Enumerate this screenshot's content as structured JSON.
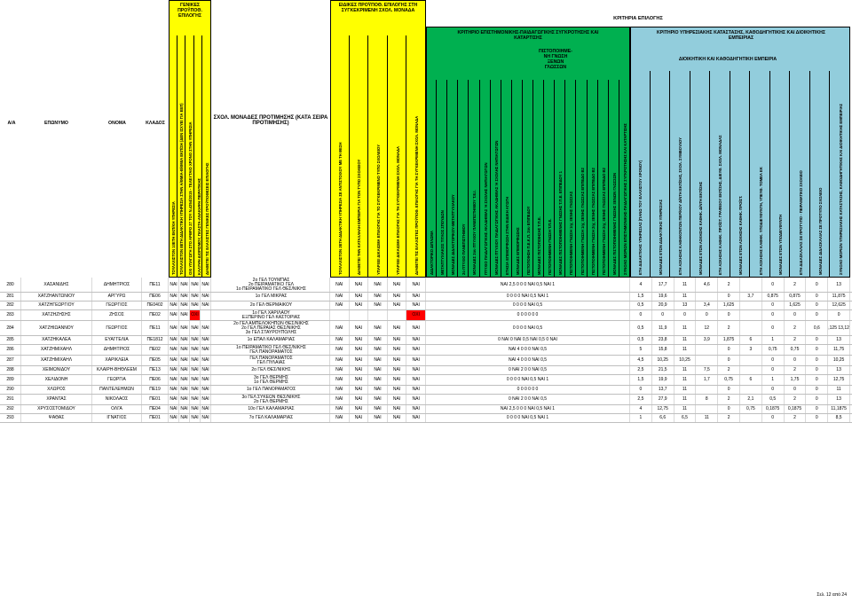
{
  "header": {
    "col_aa": "Α/Α",
    "col_surname": "ΕΠΩΝΥΜΟ",
    "col_name": "ΟΝΟΜΑ",
    "col_branch": "ΚΛΑΔΟΣ",
    "general_top": "ΓΕΝΙΚΕΣ ΠΡΟΫΠΟΘ. ΕΠΙΛΟΓΗΣ",
    "special_top": "ΕΙΔΙΚΕΣ ΠΡΟΫΠΟΘ. ΕΠΙΛΟΓΗΣ ΣΤΗ ΣΥΓΚΕΚΡΙΜΕΝΗ ΣΧΟΛ. ΜΟΝΑΔΑ",
    "criteria_top": "ΚΡΙΤΗΡΙΑ ΕΠΙΛΟΓΗΣ",
    "scientific": "ΚΡΙΤΗΡΙΟ ΕΠΙΣΤΗΜΟΝΙΚΗΣ-ΠΑΙΔΑΓΩΓΙΚΗΣ ΣΥΓΚΡΟΤΗΣΗΣ ΚΑΙ ΚΑΤΑΡΤΙΣΗΣ",
    "service": "ΚΡΙΤΗΡΙΟ ΥΠΗΡΕΣΙΑΚΗΣ ΚΑΤΑΣΤΑΣΗΣ, ΚΑΘΟΔΗΓΗΤΙΚΗΣ ΚΑΙ ΔΙΟΙΚΗΤΙΚΗΣ ΕΜΠΕΙΡΙΑΣ",
    "languages": "ΠΙΣΤΟΠΟΙΗΜΕ- ΝΗ ΓΝΩΣΗ ΞΕΝΩΝ ΓΛΩΣΣΩΝ",
    "admin": "ΔΙΟΙΚΗΤΙΚΗ ΚΑΙ ΚΑΘΟΔΗΓΗΤΙΚΗ ΕΜΠΕΙΡΙΑ",
    "school_pref": "ΣΧΟΛ. ΜΟΝΑΔΕΣ ΠΡΟΤΙΜΗΣΗΣ (ΚΑΤΑ ΣΕΙΡΑ ΠΡΟΤΙΜΗΣΗΣ)",
    "general_cols": [
      "ΤΟΥΛΑΧΙΣΤΟΝ 10ΕΤΗ ΕΚΠ/ΚΗ ΥΠΗΡΕΣΙΑ",
      "ΤΟΥΛΑΧΙΣΤΟΝ 8ΕΤΗ ΔΙΔΑΚΤΙΚΗ ΥΠΗΡΕΣΙΑ ΣΤΗΝ Α/ΘΜΙΑ-Β/ΘΜΙΑ ΕΚΠ/ΣΗ (ΔΕΝ ΙΣΧΥΕΙ ΓΙΑ ΕΕΠ)",
      "ΟΧΙ ΥΠΑΓΩΓΗ ΣΤΟ ΑΡΘΡΟ 27 ΤΟΥ Ν.4354/2015 - ΤΕΛΕΥΤΑΙΟ ΧΡΟΝΟ ΣΤΗΝ ΥΠΗΡΕΣΙΑ",
      "ΚΑΛΥΨΗ ΔΙΟΡΙΣΜΟΥ, ΠΛΑΣΤΑ-ΑΝΑΚΗΨΗ ΠΕΙΡΑΤΙΚΗΣ",
      "ΔΙΑΘΕΤΕΙ ΤΙΣ ΕΛΑΧΙΣΤΕΣ ΓΕΝΙΚΕΣ ΠΡΟΫΠΟΘΕΣΕΙΣ ΕΠΙΛΟΓΗΣ"
    ],
    "special_cols": [
      "ΤΟΥΛΑΧΙΣΤΟΝ 3ΕΤΗ ΔΙΔΑΚΤΙΚΗ ΥΠΗΡΕΣΙΑ ΣΕ ΑΝΤΙΣΤΟΙΧΟΥ ΜΕ ΤΗ ΘΕΣΗ",
      "ΔΙΑΘΕΤΕΙ ΤΗΝ ΚΑΤΑΛΛΗΛΗ ΕΜΠΕΙΡΙΑ ΓΙΑ ΤΟΝ ΤΥΠΟ ΣΧΟΛΕΙΟΥ",
      "ΥΠΑΡΧΕΙ ΔΙΚΑΙΩΜΑ ΕΠΙΛΟΓΗΣ ΓΙΑ ΤΟ ΣΥΓΚΕΚΡΙΜΕΝΟ ΤΥΠΟ ΣΧΟΛΕΙΟΥ",
      "ΥΠΑΡΧΕΙ ΔΙΚΑΙΩΜΑ ΕΠΙΛΟΓΗΣ ΓΙΑ ΤΗ ΣΥΓΚΕΚΡΙΜΕΝΗ ΣΧΟΛ. ΜΟΝΑΔΑ",
      "ΔΙΑΘΕΤΕΙ ΤΙΣ ΕΛΑΧΙΣΤΕΣ ΠΡΟΫΠΟΘ. ΕΠΙΛΟΓΗΣ ΓΙΑ ΤΗ ΣΥΓΚΕΚΡΙΜΕΝΗ ΣΧΟΛ. ΜΟΝΑΔΑ"
    ],
    "sci_cols": [
      "ΔΙΔΑΚΤΟΡΙΚΟ ΔΙΠΛΩΜΑ",
      "ΜΕΤΑΠΤΥΧΙΑΚΟΣ ΤΙΤΛΟΣ ΣΠΟΥΔΩΝ",
      "ΜΟΝΑΔΕΣ ΔΙΔΑΚΤΟΡΙΚΟΥ-ΜΕΤΑΠΤΥΧΙΑΚΟΥ",
      "2ο ΠΤΥΧΙΟ ΠΑΝΕΠΙΣΤΗΜΙΟΥ",
      "ΜΟΝΑΔΕΣ 2ου ΠΤΥΧΙΟΥ ΠΑΝΕΠΙΣΤΗΜΙΟΥ Τ.Ε.Ι.",
      "ΠΤΥΧΙΟ ΠΑΙΔΑΓΩΓΙΚΗΣ ΑΚΑΔΗΜΙΑΣ Ή ΣΧΟΛΗΣ ΝΗΠΙΑΓΩΓΩΝ",
      "ΜΟΝΑΔΕΣ ΠΤΥΧΙΟΥ ΠΑΙΔΑΓΩΓΙΚΗΣ ΑΚΑΔΗΜΙΑΣ Ή ΣΧΟΛΗΣ ΝΗΠΙΑΓΩΓΩΝ",
      "ΕΤΗΣΙΑ ΕΠΙΜΟΡΦΩΣΗ ΣΤΗΝ ΕΙΔΙΚΗ ΑΓΩΓΗ",
      "ΜΟΝΑΔΕΣ ΕΠΙΜΟΡΦΩΣΗΣ",
      "ΠΙΣΤΟΠΟΙΗΣΗ Π.Ε.Κ.Π. 2ου ΕΠΙΠΕΔΟΥ",
      "ΜΟΝΑΔΕΣ ΠΙΣΤΟΠΟΙΗΣΗΣ Τ.Π.Ε.",
      "ΠΙΣΤΟΠΟΙΗΜΕΝΗ ΓΝΩΣΗ Τ.Π.Ε.",
      "ΜΟΝΑΔΕΣ ΠΙΣΤΟΠΟΙΗΜΕΝΗΣ ΓΝΩΣΗΣ Τ.Π.Ε. ΕΠΙΠΕΔΟΥ 1",
      "ΠΙΣΤΟΠΟΙΗΜΕΝΗ ΓΝΩΣΗ 1ης ΞΕΝΗΣ ΓΛΩΣΣΑΣ",
      "ΠΙΣΤΟΠΟΙΗΜΕΝΗ ΓΝΩΣΗ 1ης ΞΕΝΗΣ ΓΛΩΣΣΑΣ ΕΠΙΠΕΔΟ Β2",
      "ΠΙΣΤΟΠΟΙΗΜΕΝΗ ΓΝΩΣΗ 2ης ΞΕΝΗΣ ΓΛΩΣΣΑΣ ΕΠΙΠΕΔΟ Β2",
      "ΠΙΣΤΟΠΟΙΗΜΕΝΗ ΓΝΩΣΗ 2ης ΞΕΝΗΣ ΓΛΩΣΣΑΣ ΕΠΙΠΕΔΟ Β2",
      "ΜΟΝΑΔΕΣ ΠΙΣΤΟΠΟΙΗΜΕΝΗΣ ΓΝΩΣΗΣ ΞΕΝΩΝ ΓΛΩΣΣΩΝ",
      "ΣΥΝΟΛΟ ΜΟΡΙΩΝ ΕΠΙΣΤΗΜΟΝΙΚΗΣ-ΠΑΙΔΑΓΩΓΙΚΗΣ ΣΥΓΚΡΟΤΗΣΗΣ ΚΑΙ ΚΑΤΑΡΤΙΣΗΣ"
    ],
    "srv_cols": [
      "ΕΤΗ ΔΙΔΑΚΤΙΚΗΣ ΥΠΗΡΕΣΙΑΣ (ΠΑΝΩ ΤΟΥ ΕΛΑΧΙΣΤΟΥ ΧΡΟΝΟΥ)",
      "ΜΟΝΑΔΕΣ ΕΤΩΝ ΔΙΔΑΚΤΙΚΗΣ ΥΠΗΡΕΣΙΑΣ",
      "ΕΤΗ ΑΣΚΗΣΗΣ ΚΑΘΗΚΟΝΤΩΝ ΠΕΡ/ΚΟΥ Δ/ΝΤΗ ΕΚΠ/ΣΗΣ, ΣΧΟΛ. ΣΥΜΒΟΥΛΟΥ",
      "ΜΟΝΑΔΕΣ ΕΤΩΝ ΑΣΚΗΣΗΣ ΚΑΘΗΚ. Δ/ΝΤΗ ΕΚΠ/ΣΗΣ",
      "ΕΤΗ ΑΣΚΗΣΗΣ ΚΑΘΗΚ. ΠΡΟΪΣΤ. ΓΡΑΦΕΙΟΥ ΕΚΠ/ΣΗΣ, ΔΙΕΥΘ. ΣΧΟΛ. ΜΟΝΑΔΑΣ",
      "ΜΟΝΑΔΕΣ ΕΤΩΝ ΑΣΚΗΣΗΣ ΚΑΘΗΚ. ΠΡΟΪΣΤ.",
      "ΕΤΗ ΑΣΚΗΣΗΣ ΚΑΘΗΚ. ΥΠΟΔΙΕΥΘΥΝΤΗ, ΥΠΕΥΘ. ΤΟΜΕΑ ΕΚ",
      "ΜΟΝΑΔΕΣ ΕΤΩΝ ΥΠΟΔΙΕΥΘΥΝΤΗ",
      "ΕΤΗ ΔΙΔΑΣΚΑΛΙΑΣ ΣΕ ΠΡΟΤΥΠΟ - ΠΕΙΡΑΜΑΤΙΚΟ ΣΧΟΛΕΙΟ",
      "ΜΟΝΑΔΕΣ ΔΙΔΑΣΚΑΛΙΑΣ ΣΕ ΠΡΟΤΥΠΟ ΣΧΟΛΕΙΟ",
      "ΣΥΝΟΛΟ ΜΟΡΙΩΝ ΥΠΗΡΕΣΙΑΚΗΣ ΚΑΤΑΣΤΑΣΗΣ, ΚΑΘΟΔΗΓΗΤΙΚΗΣ ΚΑΙ ΔΙΟΙΚΗΤΙΚΗΣ ΕΜΠΕΙΡΙΑΣ"
    ]
  },
  "rows": [
    {
      "aa": "280",
      "surname": "ΧΑΣΑΝΙΔΗΣ",
      "name": "ΔΗΜΗΤΡΙΟΣ",
      "branch": "ΠΕ11",
      "gen": [
        "ΝΑΙ",
        "ΝΑΙ",
        "ΝΑΙ",
        "ΝΑΙ"
      ],
      "schools": [
        "2ο ΓΕΛ ΤΟΥΜΠΑΣ",
        "2ο ΠΕΙΡΑΜΑΤΙΚΟ ΓΕΛ",
        "1ο ΠΕΙΡΑΜΑΤΙΚΟ ΓΕΛ ΘΕΣ/ΝΙΚΗΣ"
      ],
      "spec": [
        "ΝΑΙ",
        "ΝΑΙ",
        "ΝΑΙ",
        "ΝΑΙ",
        "ΝΑΙ"
      ],
      "sci": "ΝΑΙ 2,5 0 0 0 ΝΑΙ 0,5 ΝΑΙ 1",
      "srv": [
        "4",
        "17,7",
        "11",
        "4,6",
        "2",
        "",
        "0",
        "2",
        "0",
        "13"
      ],
      "red": false
    },
    {
      "aa": "281",
      "surname": "ΧΑΤΖΗΑΝΤΩΝΙΟΥ",
      "name": "ΑΡΓΥΡΩ",
      "branch": "ΠΕ06",
      "gen": [
        "ΝΑΙ",
        "ΝΑΙ",
        "ΝΑΙ",
        "ΝΑΙ"
      ],
      "schools": [
        "1ο ΓΕΛ ΜΙΚΡΑΣ"
      ],
      "spec": [
        "ΝΑΙ",
        "ΝΑΙ",
        "ΝΑΙ",
        "ΝΑΙ",
        "ΝΑΙ"
      ],
      "sci": "0 0 0 0 ΝΑΙ 0,5 ΝΑΙ 1",
      "srv": [
        "1,5",
        "19,6",
        "11",
        "",
        "0",
        "3,7",
        "0,875",
        "0,875",
        "0",
        "11,875"
      ],
      "red": false
    },
    {
      "aa": "282",
      "surname": "ΧΑΤΖΗΓΕΩΡΓΙΟΥ",
      "name": "ΓΕΩΡΓΙΟΣ",
      "branch": "ΠΕ0402",
      "gen": [
        "ΝΑΙ",
        "ΝΑΙ",
        "ΝΑΙ",
        "ΝΑΙ"
      ],
      "schools": [
        "2ο ΓΕΛ ΘΕΡΜΑΙΚΟΥ"
      ],
      "spec": [
        "ΝΑΙ",
        "ΝΑΙ",
        "ΝΑΙ",
        "ΝΑΙ",
        "ΝΑΙ"
      ],
      "sci": "0 0 0 0 ΝΑΙ 0,5",
      "srv": [
        "0,5",
        "20,9",
        "13",
        "3,4",
        "1,625",
        "",
        "0",
        "1,625",
        "0",
        "12,625"
      ],
      "red": false
    },
    {
      "aa": "283",
      "surname": "ΧΑΤΖΗΖΗΣΗΣ",
      "name": "ΖΗΣΟΣ",
      "branch": "ΠΕ02",
      "gen": [
        "ΝΑΙ",
        "ΝΑΙ",
        "ΟΧΙ",
        ""
      ],
      "schools": [
        "1ο ΓΕΛ ΧΑΡΙΛΑΟΥ",
        "ΕΞΠΕΡΙΝΟ ΓΕΛ ΚΑΣΤΟΡΙΑΣ"
      ],
      "spec": [
        "",
        "",
        "",
        "",
        "ΟΧΙ"
      ],
      "sci": "0 0 0 0 0 0",
      "srv": [
        "0",
        "0",
        "0",
        "0",
        "0",
        "",
        "0",
        "0",
        "0",
        "0"
      ],
      "red": true
    },
    {
      "aa": "284",
      "surname": "ΧΑΤΖΗΙΩΑΝΝΟΥ",
      "name": "ΓΕΩΡΓΙΟΣ",
      "branch": "ΠΕ11",
      "gen": [
        "ΝΑΙ",
        "ΝΑΙ",
        "ΝΑΙ",
        "ΝΑΙ"
      ],
      "schools": [
        "2ο ΓΕΛ ΑΜΠΕΛΟΚΗΠΩΝ ΘΕΣ/ΝΙΚΗΣ",
        "2ο ΓΕΛ ΠΕΡΑΙΑΣ ΘΕΣ/ΝΙΚΗΣ",
        "3ο ΓΕΛ ΣΤΑΥΡΟΥΠΟΛΗΣ"
      ],
      "spec": [
        "ΝΑΙ",
        "ΝΑΙ",
        "ΝΑΙ",
        "ΝΑΙ",
        "ΝΑΙ"
      ],
      "sci": "0 0 0 0 ΝΑΙ 0,5",
      "srv": [
        "0,5",
        "11,9",
        "11",
        "12",
        "2",
        "",
        "0",
        "2",
        "0,6",
        "0,125 13,125"
      ],
      "red": false
    },
    {
      "aa": "285",
      "surname": "ΧΑΤΖΗΚΑΛΕΑ",
      "name": "ΕΥΑΓΓΕΛΙΑ",
      "branch": "ΠΕ1812",
      "gen": [
        "ΝΑΙ",
        "ΝΑΙ",
        "ΝΑΙ",
        "ΝΑΙ"
      ],
      "schools": [
        "1ο ΕΠΑΛ ΚΑΛΑΜΑΡΙΑΣ"
      ],
      "spec": [
        "ΝΑΙ",
        "ΝΑΙ",
        "ΝΑΙ",
        "ΝΑΙ",
        "ΝΑΙ"
      ],
      "sci": "0 ΝΑΙ 0 ΝΑΙ 0,5 ΝΑΙ 0,5 0 ΝΑΙ",
      "srv": [
        "0,5",
        "23,8",
        "11",
        "3,9",
        "1,875",
        "6",
        "1",
        "2",
        "0",
        "13"
      ],
      "red": false
    },
    {
      "aa": "286",
      "surname": "ΧΑΤΖΗΜΙΧΑΗΛ",
      "name": "ΔΗΜΗΤΡΙΟΣ",
      "branch": "ΠΕ02",
      "gen": [
        "ΝΑΙ",
        "ΝΑΙ",
        "ΝΑΙ",
        "ΝΑΙ"
      ],
      "schools": [
        "1ο ΠΕΙΡΑΜΑΤΙΚΟ ΓΕΛ ΘΕΣ/ΝΙΚΗΣ",
        "ΓΕΛ ΠΑΝΟΡΑΜΑΤΟΣ"
      ],
      "spec": [
        "ΝΑΙ",
        "ΝΑΙ",
        "ΝΑΙ",
        "ΝΑΙ",
        "ΝΑΙ"
      ],
      "sci": "ΝΑΙ 4 0 0 0 ΝΑΙ 0,5",
      "srv": [
        "5",
        "15,8",
        "11",
        "",
        "0",
        "3",
        "0,75",
        "0,75",
        "0",
        "11,75"
      ],
      "red": false
    },
    {
      "aa": "287",
      "surname": "ΧΑΤΖΗΜΙΧΑΗΛ",
      "name": "ΧΑΡΙΚΛΕΙΑ",
      "branch": "ΠΕ05",
      "gen": [
        "ΝΑΙ",
        "ΝΑΙ",
        "ΝΑΙ",
        "ΝΑΙ"
      ],
      "schools": [
        "ΓΕΛ ΠΑΝΟΡΑΜΑΤΟΣ",
        "ΓΕΛ ΠΥΛΑΙΑΣ"
      ],
      "spec": [
        "ΝΑΙ",
        "ΝΑΙ",
        "ΝΑΙ",
        "ΝΑΙ",
        "ΝΑΙ"
      ],
      "sci": "ΝΑΙ 4 0 0 0 ΝΑΙ 0,5",
      "srv": [
        "4,5",
        "10,25",
        "10,25",
        "",
        "0",
        "",
        "0",
        "0",
        "0",
        "10,25"
      ],
      "red": false
    },
    {
      "aa": "288",
      "surname": "ΧΕΙΜΩΝΙΔΟΥ",
      "name": "ΚΛΑΙΡΗ-ΒΗΘΛΕΕΜ",
      "branch": "ΠΕ13",
      "gen": [
        "ΝΑΙ",
        "ΝΑΙ",
        "ΝΑΙ",
        "ΝΑΙ"
      ],
      "schools": [
        "2ο ΓΕΛ ΘΕΣ/ΝΙΚΗΣ"
      ],
      "spec": [
        "ΝΑΙ",
        "ΝΑΙ",
        "ΝΑΙ",
        "ΝΑΙ",
        "ΝΑΙ"
      ],
      "sci": "0 ΝΑΙ 2 0 0 ΝΑΙ 0,5",
      "srv": [
        "2,5",
        "21,5",
        "11",
        "7,5",
        "2",
        "",
        "0",
        "2",
        "0",
        "13"
      ],
      "red": false
    },
    {
      "aa": "289",
      "surname": "ΧΕΛΙΔΟΝΗ",
      "name": "ΓΕΩΡΓΙΑ",
      "branch": "ΠΕ06",
      "gen": [
        "ΝΑΙ",
        "ΝΑΙ",
        "ΝΑΙ",
        "ΝΑΙ"
      ],
      "schools": [
        "3ο ΓΕΛ ΘΕΡΜΗΣ",
        "1ο ΓΕΛ ΘΕΡΜΗΣ"
      ],
      "spec": [
        "ΝΑΙ",
        "ΝΑΙ",
        "ΝΑΙ",
        "ΝΑΙ",
        "ΝΑΙ"
      ],
      "sci": "0 0 0 0 ΝΑΙ 0,5 ΝΑΙ 1",
      "srv": [
        "1,5",
        "19,9",
        "11",
        "1,7",
        "0,75",
        "6",
        "1",
        "1,75",
        "0",
        "12,75"
      ],
      "red": false
    },
    {
      "aa": "290",
      "surname": "ΧΛΩΡΟΣ",
      "name": "ΠΑΝΤΕΛΕΗΜΩΝ",
      "branch": "ΠΕ19",
      "gen": [
        "ΝΑΙ",
        "ΝΑΙ",
        "ΝΑΙ",
        "ΝΑΙ"
      ],
      "schools": [
        "1ο ΓΕΛ ΠΑΝΟΡΑΜΑΤΟΣ"
      ],
      "spec": [
        "ΝΑΙ",
        "ΝΑΙ",
        "ΝΑΙ",
        "ΝΑΙ",
        "ΝΑΙ"
      ],
      "sci": "0 0 0 0 0 0",
      "srv": [
        "0",
        "13,7",
        "11",
        "",
        "0",
        "",
        "0",
        "0",
        "0",
        "11"
      ],
      "red": false
    },
    {
      "aa": "291",
      "surname": "ΧΡΑΝΤΑΣ",
      "name": "ΝΙΚΟΛΑΟΣ",
      "branch": "ΠΕ01",
      "gen": [
        "ΝΑΙ",
        "ΝΑΙ",
        "ΝΑΙ",
        "ΝΑΙ"
      ],
      "schools": [
        "3ο ΓΕΛ ΣΥΚΕΩΝ ΘΕΣ/ΝΙΚΗΣ",
        "2ο ΓΕΛ ΘΕΡΜΗΣ"
      ],
      "spec": [
        "ΝΑΙ",
        "ΝΑΙ",
        "ΝΑΙ",
        "ΝΑΙ",
        "ΝΑΙ"
      ],
      "sci": "0 ΝΑΙ 2 0 0 ΝΑΙ 0,5",
      "srv": [
        "2,5",
        "27,9",
        "11",
        "8",
        "2",
        "2,1",
        "0,5",
        "2",
        "0",
        "13"
      ],
      "red": false
    },
    {
      "aa": "292",
      "surname": "ΧΡΥΣΟΣΤΟΜΙΔΟΥ",
      "name": "ΟΛΓΑ",
      "branch": "ΠΕ04",
      "gen": [
        "ΝΑΙ",
        "ΝΑΙ",
        "ΝΑΙ",
        "ΝΑΙ"
      ],
      "schools": [
        "10ο ΓΕΛ ΚΑΛΑΜΑΡΙΑΣ"
      ],
      "spec": [
        "ΝΑΙ",
        "ΝΑΙ",
        "ΝΑΙ",
        "ΝΑΙ",
        "ΝΑΙ"
      ],
      "sci": "ΝΑΙ 2,5 0 0 0 ΝΑΙ 0,5 ΝΑΙ 1",
      "srv": [
        "4",
        "12,75",
        "11",
        "",
        "0",
        "0,75",
        "0,1875",
        "0,1875",
        "0",
        "11,1875"
      ],
      "red": false
    },
    {
      "aa": "293",
      "surname": "ΨΑΘΑΣ",
      "name": "ΙΓΝΑΤΙΟΣ",
      "branch": "ΠΕ01",
      "gen": [
        "ΝΑΙ",
        "ΝΑΙ",
        "ΝΑΙ",
        "ΝΑΙ"
      ],
      "schools": [
        "7ο ΓΕΛ ΚΑΛΑΜΑΡΙΑΣ"
      ],
      "spec": [
        "ΝΑΙ",
        "ΝΑΙ",
        "ΝΑΙ",
        "ΝΑΙ",
        "ΝΑΙ"
      ],
      "sci": "0 0 0 0 ΝΑΙ 0,5 ΝΑΙ 1",
      "srv": [
        "1",
        "6,6",
        "6,5",
        "11",
        "2",
        "",
        "0",
        "2",
        "0",
        "8,5"
      ],
      "red": false
    }
  ],
  "footer": "Σελ. 12 από 24",
  "colors": {
    "yellow": "#ffff00",
    "green": "#00b050",
    "cyan": "#92cddc",
    "lgreen": "#c4d79b",
    "red": "#ff0000"
  }
}
